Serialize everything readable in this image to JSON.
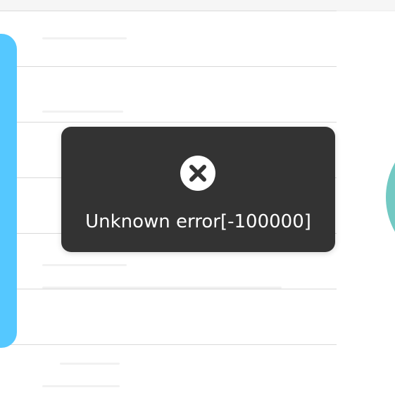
{
  "colors": {
    "accent_blue": "#55c8ff",
    "accent_teal": "#72c9c3",
    "toast_background": "#333333",
    "toast_text": "#ffffff",
    "divider": "#d9d9d9"
  },
  "toast": {
    "icon": "close-circle-icon",
    "message": "Unknown error[-100000]"
  }
}
